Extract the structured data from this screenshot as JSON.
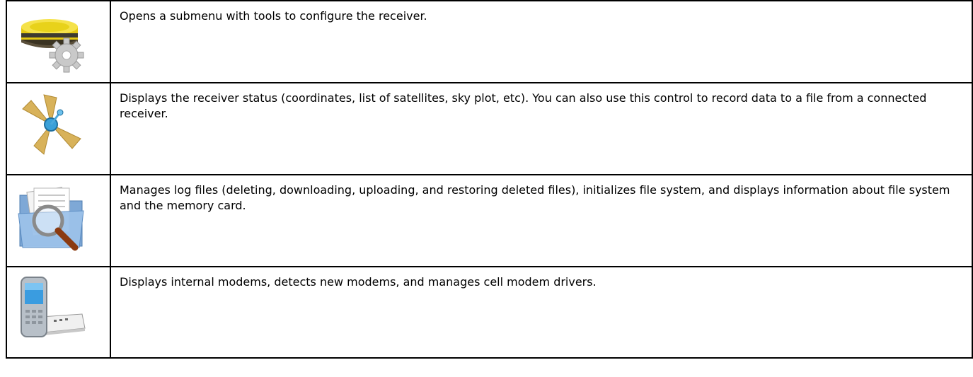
{
  "rows": [
    {
      "icon": "receiver-config-icon",
      "description": "Opens a submenu with tools to configure the receiver."
    },
    {
      "icon": "satellite-status-icon",
      "description": "Displays the receiver status (coordinates, list of satellites, sky plot, etc). You can also use this control to record data to a file from a connected receiver."
    },
    {
      "icon": "file-manager-icon",
      "description": "Manages log files (deleting, downloading, uploading, and restoring deleted files), initializes file system, and displays information about file system and the memory card."
    },
    {
      "icon": "modem-icon",
      "description": "Displays internal modems, detects new modems, and manages cell modem drivers."
    }
  ],
  "colors": {
    "border": "#000000",
    "background": "#ffffff",
    "text": "#000000"
  }
}
